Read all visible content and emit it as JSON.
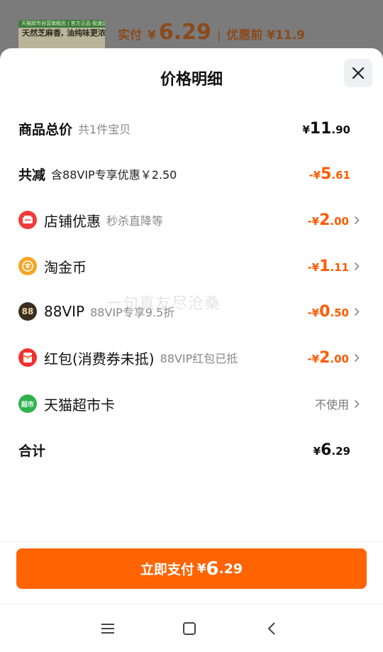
{
  "background": {
    "thumb_top_text": "天猫超市自营旗舰店 | 官方正品 极速送达",
    "thumb_text": "天然芝麻香, 油纯味更浓",
    "pay_label": "实付",
    "pay_yen": "¥",
    "pay_amount": "6.29",
    "separator": "|",
    "orig_text": "优惠前 ¥11.9"
  },
  "sheet": {
    "title": "价格明细",
    "close_icon": "close-icon"
  },
  "rows": [
    {
      "label": "商品总价",
      "sub": "共1件宝贝",
      "amount_yen": "¥",
      "amount_int": "11",
      "amount_dec": ".90",
      "color": "#111111"
    },
    {
      "label": "共减",
      "sub": "含88VIP专享优惠￥2.50",
      "amount_yen": "-¥",
      "amount_int": "5",
      "amount_dec": ".61",
      "color": "#ff5a00"
    },
    {
      "label": "店铺优惠",
      "sub": "秒杀直降等",
      "icon": "shop-coupon-icon",
      "amount_yen": "-¥",
      "amount_int": "2",
      "amount_dec": ".00",
      "color": "#ff5a00"
    },
    {
      "label": "淘金币",
      "icon": "gold-coin-icon",
      "amount_yen": "-¥",
      "amount_int": "1",
      "amount_dec": ".11",
      "color": "#ff5a00"
    },
    {
      "label": "88VIP",
      "sub": "88VIP专享9.5折",
      "icon": "vip-88-icon",
      "icon_text": "88",
      "amount_yen": "-¥",
      "amount_int": "0",
      "amount_dec": ".50",
      "color": "#ff5a00"
    },
    {
      "label": "红包(消费券未抵)",
      "sub": "88VIP红包已抵",
      "icon": "red-packet-icon",
      "amount_yen": "-¥",
      "amount_int": "2",
      "amount_dec": ".00",
      "color": "#ff5a00"
    },
    {
      "label": "天猫超市卡",
      "icon": "tmall-supermarket-card-icon",
      "icon_text": "超市",
      "value": "不使用"
    },
    {
      "label": "合计",
      "amount_yen": "¥",
      "amount_int": "6",
      "amount_dec": ".29",
      "color": "#111111"
    }
  ],
  "watermark": "一句真友尽沧桑",
  "pay_button": {
    "label": "立即支付",
    "yen": "¥",
    "int": "6",
    "dec": ".29",
    "color": "#ff6400"
  },
  "nav": {
    "menu_icon": "menu-icon",
    "home_icon": "home-square-icon",
    "back_icon": "back-chevron-icon"
  }
}
